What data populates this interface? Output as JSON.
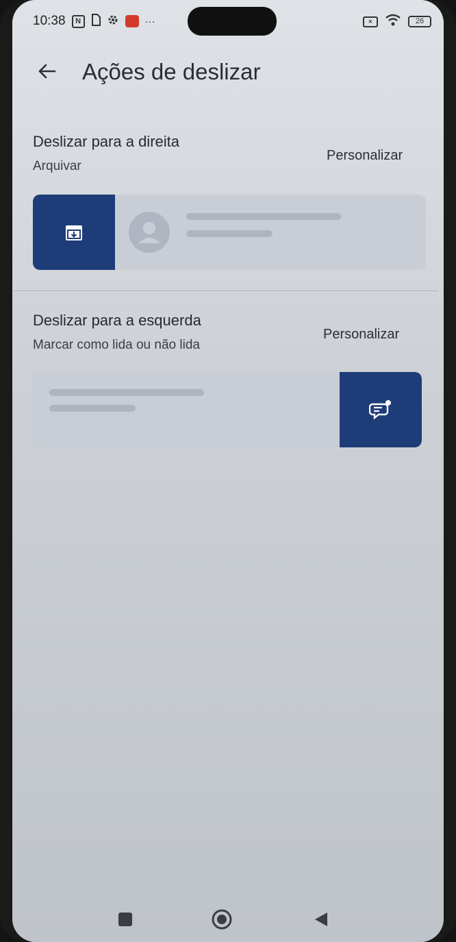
{
  "status_bar": {
    "time": "10:38",
    "icons": [
      "nfc-icon",
      "sim-icon",
      "gear-icon",
      "mail-icon",
      "more-icon"
    ],
    "battery": "26"
  },
  "header": {
    "title": "Ações de deslizar"
  },
  "swipe_right": {
    "title": "Deslizar para a direita",
    "action": "Arquivar",
    "customize_label": "Personalizar",
    "action_icon": "archive-icon"
  },
  "swipe_left": {
    "title": "Deslizar para a esquerda",
    "action": "Marcar como lida ou não lida",
    "customize_label": "Personalizar",
    "action_icon": "mark-read-icon"
  },
  "nav_bar": {
    "recents_icon": "square-icon",
    "home_icon": "circle-icon",
    "back_icon": "triangle-back-icon"
  },
  "colors": {
    "action_bg": "#1d3c78",
    "screen_bg": "#dfe2e6"
  }
}
